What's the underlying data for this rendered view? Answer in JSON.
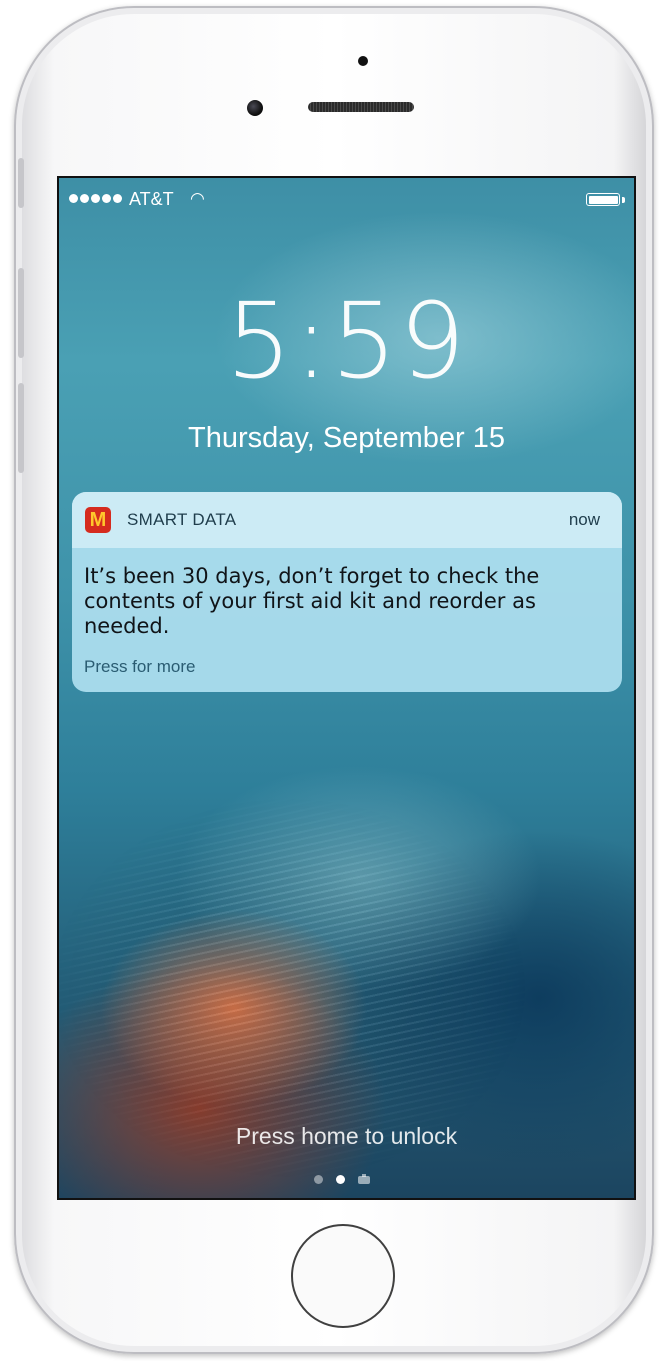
{
  "status_bar": {
    "carrier": "AT&T",
    "wifi_icon": "wifi-icon",
    "battery_icon": "battery-full-icon",
    "signal_bars": 5
  },
  "lock_screen": {
    "time": "5:59",
    "date": "Thursday, September 15",
    "unlock_hint": "Press home to unlock",
    "page_count": 2,
    "active_page": 1
  },
  "notification": {
    "app_icon": "mcdonalds-logo-icon",
    "app_icon_glyph": "M",
    "app_name": "SMART DATA",
    "time": "now",
    "message": "It’s been 30 days, don’t forget to check the contents of your first aid kit and reorder as needed.",
    "action_hint": "Press for more"
  },
  "colors": {
    "notification_bg": "#afe0f0",
    "app_icon_bg": "#d52b1e",
    "app_icon_fg": "#ffc72c"
  }
}
